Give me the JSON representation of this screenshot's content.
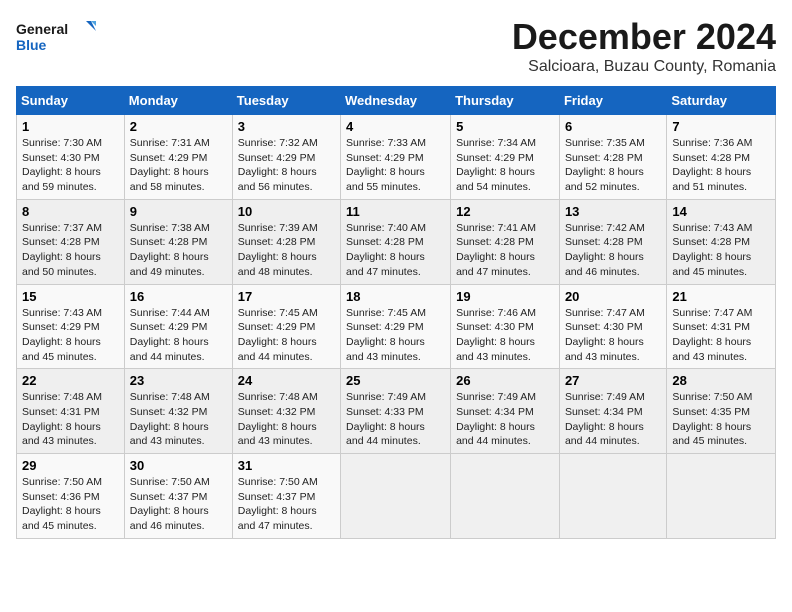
{
  "logo": {
    "text_general": "General",
    "text_blue": "Blue"
  },
  "header": {
    "month": "December 2024",
    "location": "Salcioara, Buzau County, Romania"
  },
  "weekdays": [
    "Sunday",
    "Monday",
    "Tuesday",
    "Wednesday",
    "Thursday",
    "Friday",
    "Saturday"
  ],
  "weeks": [
    [
      {
        "day": "1",
        "sunrise": "7:30 AM",
        "sunset": "4:30 PM",
        "daylight": "8 hours and 59 minutes."
      },
      {
        "day": "2",
        "sunrise": "7:31 AM",
        "sunset": "4:29 PM",
        "daylight": "8 hours and 58 minutes."
      },
      {
        "day": "3",
        "sunrise": "7:32 AM",
        "sunset": "4:29 PM",
        "daylight": "8 hours and 56 minutes."
      },
      {
        "day": "4",
        "sunrise": "7:33 AM",
        "sunset": "4:29 PM",
        "daylight": "8 hours and 55 minutes."
      },
      {
        "day": "5",
        "sunrise": "7:34 AM",
        "sunset": "4:29 PM",
        "daylight": "8 hours and 54 minutes."
      },
      {
        "day": "6",
        "sunrise": "7:35 AM",
        "sunset": "4:28 PM",
        "daylight": "8 hours and 52 minutes."
      },
      {
        "day": "7",
        "sunrise": "7:36 AM",
        "sunset": "4:28 PM",
        "daylight": "8 hours and 51 minutes."
      }
    ],
    [
      {
        "day": "8",
        "sunrise": "7:37 AM",
        "sunset": "4:28 PM",
        "daylight": "8 hours and 50 minutes."
      },
      {
        "day": "9",
        "sunrise": "7:38 AM",
        "sunset": "4:28 PM",
        "daylight": "8 hours and 49 minutes."
      },
      {
        "day": "10",
        "sunrise": "7:39 AM",
        "sunset": "4:28 PM",
        "daylight": "8 hours and 48 minutes."
      },
      {
        "day": "11",
        "sunrise": "7:40 AM",
        "sunset": "4:28 PM",
        "daylight": "8 hours and 47 minutes."
      },
      {
        "day": "12",
        "sunrise": "7:41 AM",
        "sunset": "4:28 PM",
        "daylight": "8 hours and 47 minutes."
      },
      {
        "day": "13",
        "sunrise": "7:42 AM",
        "sunset": "4:28 PM",
        "daylight": "8 hours and 46 minutes."
      },
      {
        "day": "14",
        "sunrise": "7:43 AM",
        "sunset": "4:28 PM",
        "daylight": "8 hours and 45 minutes."
      }
    ],
    [
      {
        "day": "15",
        "sunrise": "7:43 AM",
        "sunset": "4:29 PM",
        "daylight": "8 hours and 45 minutes."
      },
      {
        "day": "16",
        "sunrise": "7:44 AM",
        "sunset": "4:29 PM",
        "daylight": "8 hours and 44 minutes."
      },
      {
        "day": "17",
        "sunrise": "7:45 AM",
        "sunset": "4:29 PM",
        "daylight": "8 hours and 44 minutes."
      },
      {
        "day": "18",
        "sunrise": "7:45 AM",
        "sunset": "4:29 PM",
        "daylight": "8 hours and 43 minutes."
      },
      {
        "day": "19",
        "sunrise": "7:46 AM",
        "sunset": "4:30 PM",
        "daylight": "8 hours and 43 minutes."
      },
      {
        "day": "20",
        "sunrise": "7:47 AM",
        "sunset": "4:30 PM",
        "daylight": "8 hours and 43 minutes."
      },
      {
        "day": "21",
        "sunrise": "7:47 AM",
        "sunset": "4:31 PM",
        "daylight": "8 hours and 43 minutes."
      }
    ],
    [
      {
        "day": "22",
        "sunrise": "7:48 AM",
        "sunset": "4:31 PM",
        "daylight": "8 hours and 43 minutes."
      },
      {
        "day": "23",
        "sunrise": "7:48 AM",
        "sunset": "4:32 PM",
        "daylight": "8 hours and 43 minutes."
      },
      {
        "day": "24",
        "sunrise": "7:48 AM",
        "sunset": "4:32 PM",
        "daylight": "8 hours and 43 minutes."
      },
      {
        "day": "25",
        "sunrise": "7:49 AM",
        "sunset": "4:33 PM",
        "daylight": "8 hours and 44 minutes."
      },
      {
        "day": "26",
        "sunrise": "7:49 AM",
        "sunset": "4:34 PM",
        "daylight": "8 hours and 44 minutes."
      },
      {
        "day": "27",
        "sunrise": "7:49 AM",
        "sunset": "4:34 PM",
        "daylight": "8 hours and 44 minutes."
      },
      {
        "day": "28",
        "sunrise": "7:50 AM",
        "sunset": "4:35 PM",
        "daylight": "8 hours and 45 minutes."
      }
    ],
    [
      {
        "day": "29",
        "sunrise": "7:50 AM",
        "sunset": "4:36 PM",
        "daylight": "8 hours and 45 minutes."
      },
      {
        "day": "30",
        "sunrise": "7:50 AM",
        "sunset": "4:37 PM",
        "daylight": "8 hours and 46 minutes."
      },
      {
        "day": "31",
        "sunrise": "7:50 AM",
        "sunset": "4:37 PM",
        "daylight": "8 hours and 47 minutes."
      },
      null,
      null,
      null,
      null
    ]
  ]
}
